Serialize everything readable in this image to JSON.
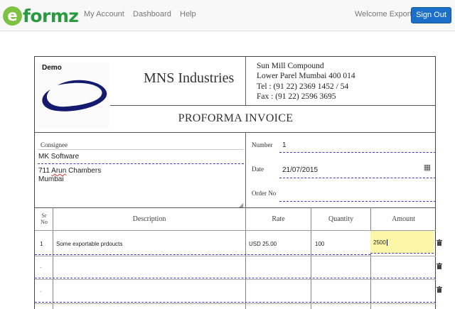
{
  "navbar": {
    "logo_letter": "e",
    "logo_text": "formz",
    "links": [
      "My Account",
      "Dashboard",
      "Help"
    ],
    "welcome": "Welcome Export",
    "signout_label": "Sign Out",
    "accent_color": "#1b6fc8",
    "brand_color": "#2a9a40"
  },
  "invoice": {
    "demo_label": "Demo",
    "company_name": "MNS Industries",
    "address_lines": [
      "Sun Mill Compound",
      "Lower Parel Mumbai 400 014",
      "Tel : (91 22) 2369 1452 / 54",
      "Fax : (91 22) 2596 3695"
    ],
    "title": "PROFORMA INVOICE",
    "consignee_label": "Consignee",
    "consignee_name": "MK Software",
    "consignee_address_line1_pre": "711 ",
    "consignee_address_line1_word": "Arun",
    "consignee_address_line1_post": " Chambers",
    "consignee_address_line2": "Mumbai",
    "number_label": "Number",
    "number_value": "1",
    "date_label": "Date",
    "date_value": "21/07/2015",
    "calendar_icon": "calendar-icon",
    "order_label": "Order No",
    "order_value": "",
    "columns": {
      "srno": "Sr No",
      "description": "Description",
      "rate": "Rate",
      "quantity": "Quantity",
      "amount": "Amount"
    },
    "rows": [
      {
        "srno": "1",
        "description": "Some exportable prdoucts",
        "rate": "USD 25.00",
        "quantity": "100",
        "amount": "2500"
      },
      {
        "srno": "-",
        "description": "",
        "rate": "",
        "quantity": "",
        "amount": ""
      },
      {
        "srno": "-",
        "description": "",
        "rate": "",
        "quantity": "",
        "amount": ""
      }
    ],
    "delete_icon": "trash-icon"
  }
}
